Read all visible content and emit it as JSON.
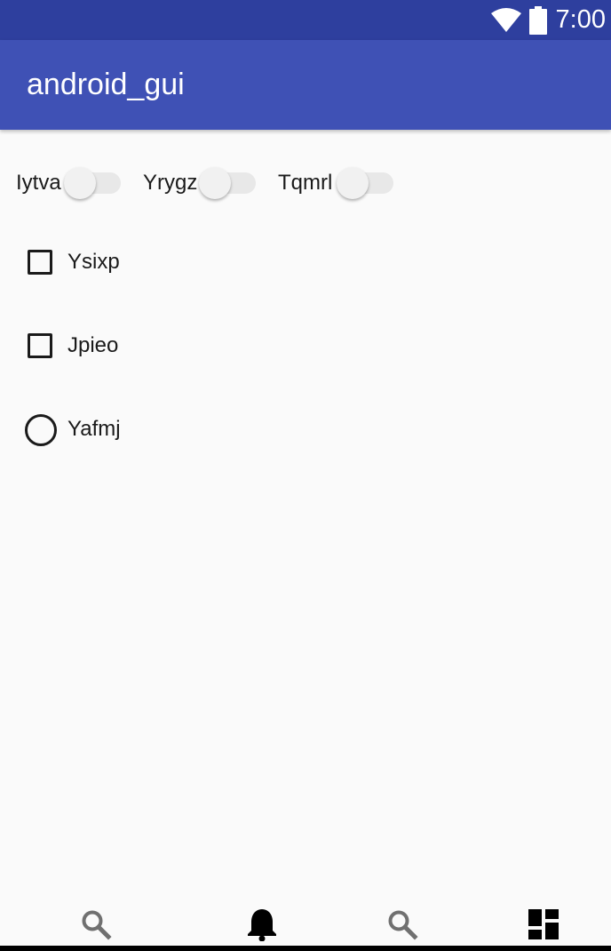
{
  "status_bar": {
    "time": "7:00",
    "icons": [
      "wifi-icon",
      "battery-icon"
    ],
    "background": "#2e3f9e"
  },
  "app_bar": {
    "title": "android_gui",
    "background": "#3f51b5"
  },
  "switches": [
    {
      "label": "Iytva",
      "checked": false
    },
    {
      "label": "Yrygz",
      "checked": false
    },
    {
      "label": "Tqmrl",
      "checked": false
    }
  ],
  "checkboxes": [
    {
      "label": "Ysixp",
      "checked": false
    },
    {
      "label": "Jpieo",
      "checked": false
    }
  ],
  "radio": {
    "label": "Yafmj",
    "checked": false
  },
  "bottom_nav": {
    "items": [
      {
        "icon": "search-icon",
        "color": "#707070"
      },
      {
        "icon": "bell-icon",
        "color": "#000000"
      },
      {
        "icon": "search-icon",
        "color": "#707070"
      },
      {
        "icon": "dashboard-icon",
        "color": "#000000"
      }
    ]
  }
}
